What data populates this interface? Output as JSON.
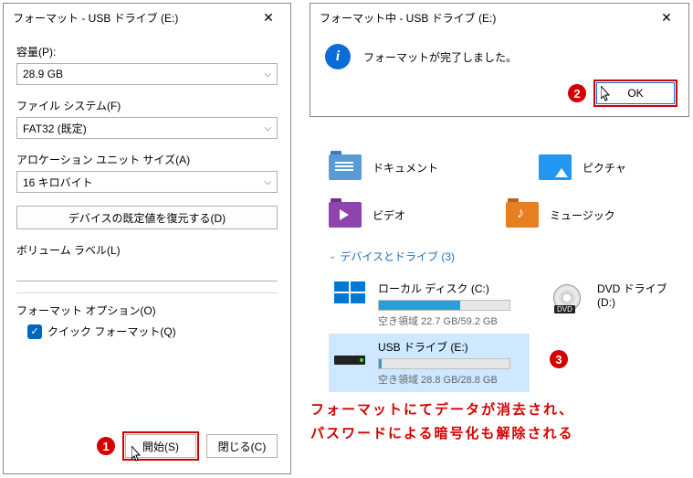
{
  "formatDialog": {
    "title": "フォーマット - USB ドライブ (E:)",
    "capacityLabel": "容量(P):",
    "capacityValue": "28.9 GB",
    "fsLabel": "ファイル システム(F)",
    "fsValue": "FAT32 (既定)",
    "allocLabel": "アロケーション ユニット サイズ(A)",
    "allocValue": "16 キロバイト",
    "restoreBtn": "デバイスの既定値を復元する(D)",
    "volumeLabel": "ボリューム ラベル(L)",
    "optionsLabel": "フォーマット オプション(O)",
    "quickFormat": "クイック フォーマット(Q)",
    "startBtn": "開始(S)",
    "closeBtn": "閉じる(C)"
  },
  "confirmDialog": {
    "title": "フォーマット中 - USB ドライブ (E:)",
    "message": "フォーマットが完了しました。",
    "okBtn": "OK"
  },
  "explorer": {
    "tiles": {
      "documents": "ドキュメント",
      "pictures": "ピクチャ",
      "videos": "ビデオ",
      "music": "ミュージック"
    },
    "sectionHeader": "デバイスとドライブ (3)",
    "drives": {
      "local": {
        "name": "ローカル ディスク (C:)",
        "space": "空き領域 22.7 GB/59.2 GB",
        "fillPct": 62
      },
      "usb": {
        "name": "USB ドライブ (E:)",
        "space": "空き領域 28.8 GB/28.8 GB",
        "fillPct": 2
      },
      "dvd": {
        "name": "DVD ドライブ (D:)"
      }
    }
  },
  "annotation": {
    "line1": "フォーマットにてデータが消去され、",
    "line2": "パスワードによる暗号化も解除される",
    "badge1": "1",
    "badge2": "2",
    "badge3": "3"
  }
}
